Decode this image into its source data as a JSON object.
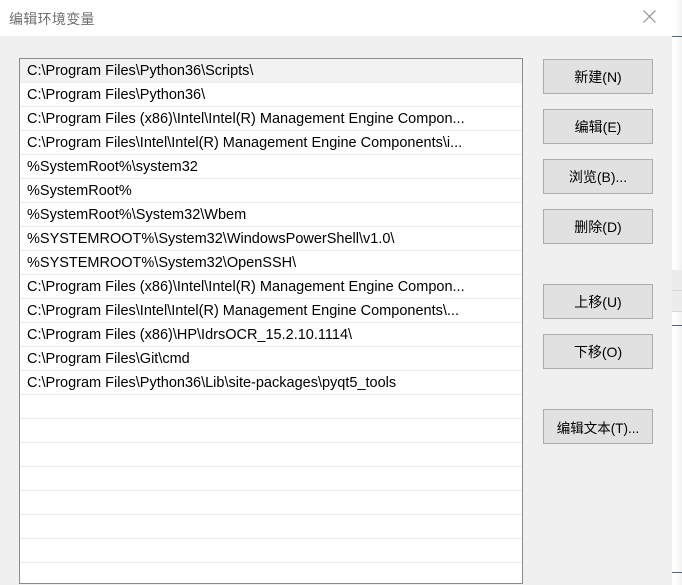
{
  "window": {
    "title": "编辑环境变量",
    "close_icon": "close-icon"
  },
  "list": {
    "selected_index": 0,
    "entries": [
      "C:\\Program Files\\Python36\\Scripts\\",
      "C:\\Program Files\\Python36\\",
      "C:\\Program Files (x86)\\Intel\\Intel(R) Management Engine Compon...",
      "C:\\Program Files\\Intel\\Intel(R) Management Engine Components\\i...",
      "%SystemRoot%\\system32",
      "%SystemRoot%",
      "%SystemRoot%\\System32\\Wbem",
      "%SYSTEMROOT%\\System32\\WindowsPowerShell\\v1.0\\",
      "%SYSTEMROOT%\\System32\\OpenSSH\\",
      "C:\\Program Files (x86)\\Intel\\Intel(R) Management Engine Compon...",
      "C:\\Program Files\\Intel\\Intel(R) Management Engine Components\\...",
      "C:\\Program Files (x86)\\HP\\IdrsOCR_15.2.10.1114\\",
      "C:\\Program Files\\Git\\cmd",
      "C:\\Program Files\\Python36\\Lib\\site-packages\\pyqt5_tools"
    ],
    "empty_row_count": 8
  },
  "buttons": {
    "new": "新建(N)",
    "edit": "编辑(E)",
    "browse": "浏览(B)...",
    "delete": "删除(D)",
    "move_up": "上移(U)",
    "move_down": "下移(O)",
    "edit_text": "编辑文本(T)..."
  },
  "colors": {
    "dialog_background": "#f0f0f0",
    "titlebar_background": "#ffffff",
    "title_text": "#6f6f6f",
    "listbox_background": "#ffffff",
    "listbox_border": "#8c8c8c",
    "row_separator": "#ececec",
    "row_selected": "#f2f2f2",
    "button_face": "#e1e1e1",
    "button_border": "#adadad",
    "text": "#000000"
  }
}
